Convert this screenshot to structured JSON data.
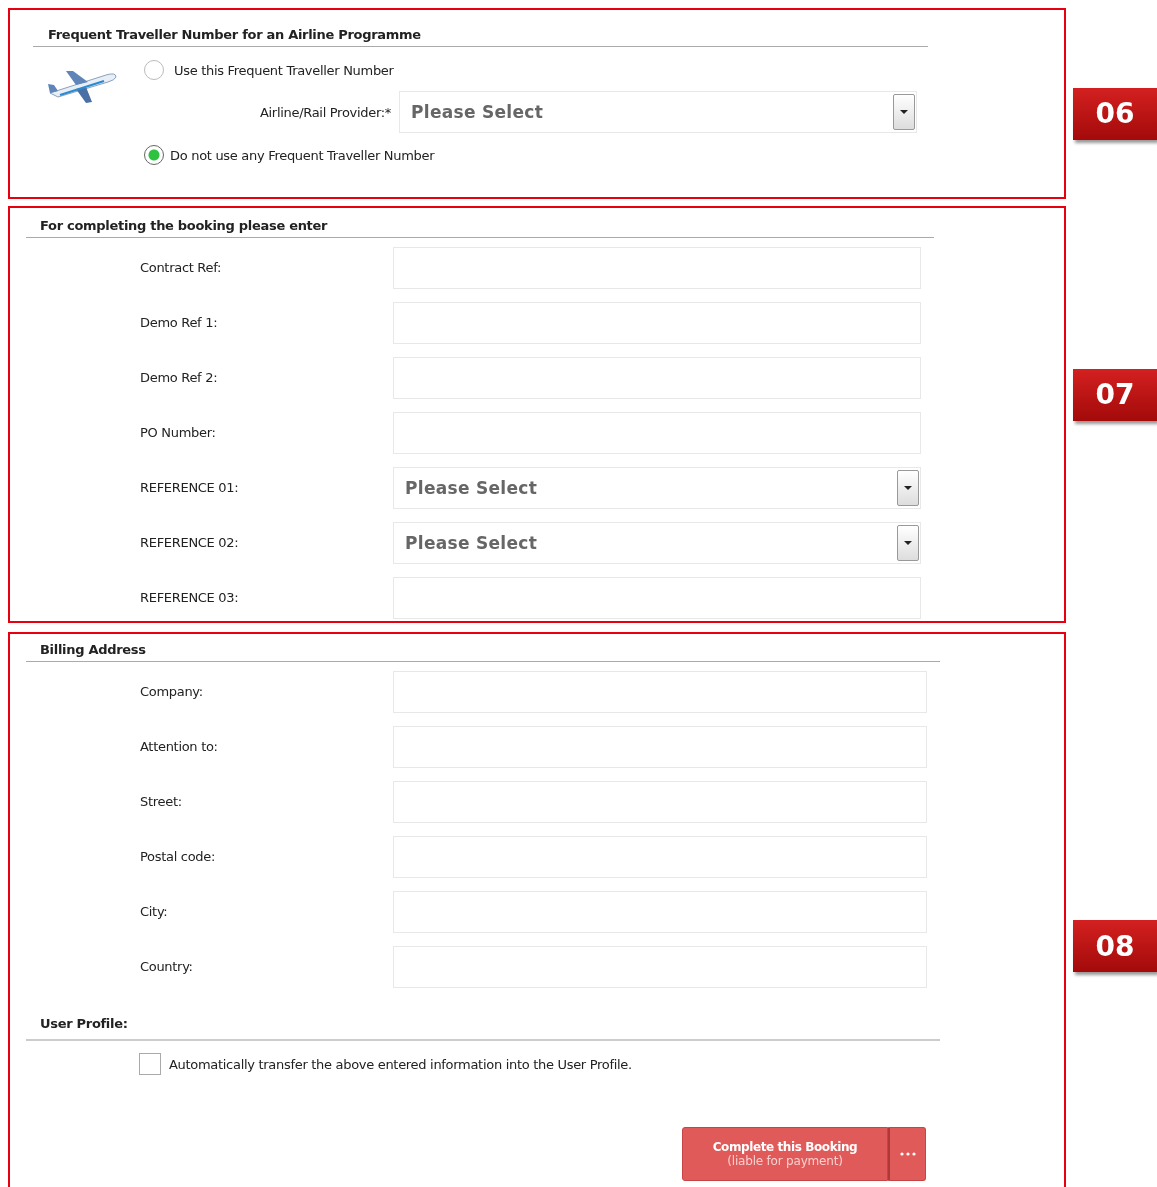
{
  "frequent_traveller": {
    "badge": "06",
    "heading": "Frequent Traveller Number for an Airline Programme",
    "options": [
      {
        "label": "Use this Frequent Traveller Number",
        "selected": false
      },
      {
        "label": "Do not use any Frequent Traveller Number",
        "selected": true
      }
    ],
    "provider": {
      "label": "Airline/Rail Provider:*",
      "value": "Please Select"
    }
  },
  "booking_details": {
    "badge": "07",
    "heading": "For completing the booking please enter",
    "fields": [
      {
        "label": "Contract Ref:",
        "kind": "text"
      },
      {
        "label": "Demo Ref 1:",
        "kind": "text"
      },
      {
        "label": "Demo Ref 2:",
        "kind": "text"
      },
      {
        "label": "PO Number:",
        "kind": "text"
      },
      {
        "label": "REFERENCE 01:",
        "kind": "select",
        "value": "Please Select"
      },
      {
        "label": "REFERENCE 02:",
        "kind": "select",
        "value": "Please Select"
      },
      {
        "label": "REFERENCE 03:",
        "kind": "text"
      }
    ]
  },
  "billing_address": {
    "badge": "08",
    "heading": "Billing Address",
    "fields": [
      {
        "label": "Company:",
        "kind": "text"
      },
      {
        "label": "Attention to:",
        "kind": "text"
      },
      {
        "label": "Street:",
        "kind": "text"
      },
      {
        "label": "Postal code:",
        "kind": "text"
      },
      {
        "label": "City:",
        "kind": "text"
      },
      {
        "label": "Country:",
        "kind": "text"
      }
    ],
    "user_profile": {
      "heading": "User Profile:",
      "option": {
        "label": "Automatically transfer the above entered information into the User Profile.",
        "checked": false
      }
    },
    "submit": {
      "label": "Complete this Booking",
      "sublabel": "(liable for payment)"
    }
  }
}
